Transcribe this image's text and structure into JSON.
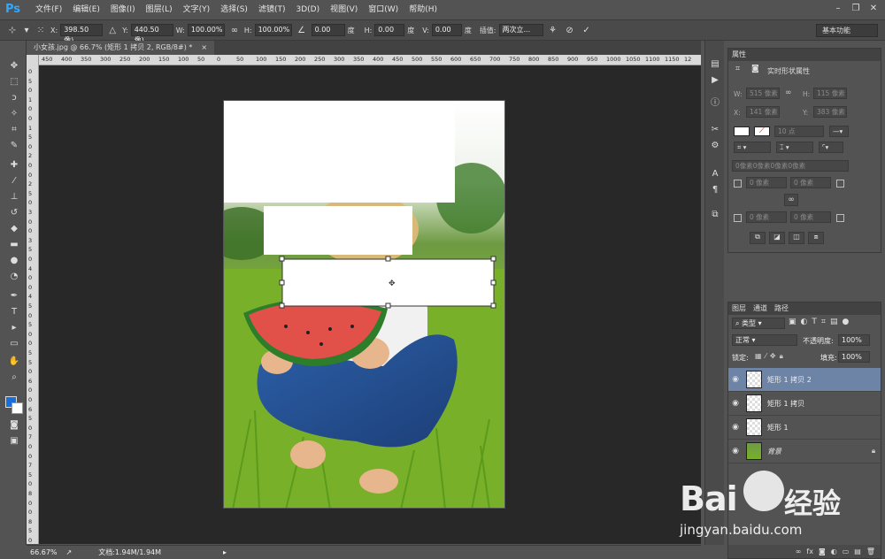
{
  "app": {
    "logo": "Ps"
  },
  "menu": [
    "文件(F)",
    "编辑(E)",
    "图像(I)",
    "图层(L)",
    "文字(Y)",
    "选择(S)",
    "滤镜(T)",
    "3D(D)",
    "视图(V)",
    "窗口(W)",
    "帮助(H)"
  ],
  "options": {
    "x_label": "X:",
    "x_value": "398.50 像)",
    "y_label": "Y:",
    "y_value": "440.50 像)",
    "w_label": "W:",
    "w_value": "100.00%",
    "h_label": "H:",
    "h_value": "100.00%",
    "angle_value": "0.00",
    "angle_unit": "度",
    "hskew_label": "H:",
    "hskew_value": "0.00",
    "hskew_unit": "度",
    "vskew_label": "V:",
    "vskew_value": "0.00",
    "vskew_unit": "度",
    "interp_label": "插值:",
    "interp_value": "两次立...",
    "workspace": "基本功能"
  },
  "document": {
    "tab_title": "小女孩.jpg @ 66.7% (矩形 1 拷贝 2, RGB/8#) *",
    "tab_close": "×",
    "zoom": "66.67%",
    "doc_info": "文档:1.94M/1.94M"
  },
  "ruler": {
    "h_ticks": [
      "450",
      "400",
      "350",
      "300",
      "250",
      "200",
      "150",
      "100",
      "50",
      "0",
      "50",
      "100",
      "150",
      "200",
      "250",
      "300",
      "350",
      "400",
      "450",
      "500",
      "550",
      "600",
      "650",
      "700",
      "750",
      "800",
      "850",
      "900",
      "950",
      "1000",
      "1050",
      "1100",
      "1150",
      "12"
    ],
    "v_ticks": [
      "0",
      "5",
      "0",
      "1",
      "0",
      "0",
      "1",
      "5",
      "0",
      "2",
      "0",
      "0",
      "2",
      "5",
      "0",
      "3",
      "0",
      "0",
      "3",
      "5",
      "0",
      "4",
      "0",
      "0",
      "4",
      "5",
      "0",
      "5",
      "0",
      "0",
      "5",
      "5",
      "0",
      "6",
      "0",
      "0",
      "6",
      "5",
      "0",
      "7",
      "0",
      "0",
      "7",
      "5",
      "0",
      "8",
      "0",
      "0",
      "8",
      "5",
      "0"
    ]
  },
  "properties": {
    "tab_label": "属性",
    "title": "实时形状属性",
    "w_label": "W:",
    "w_value": "515 像素",
    "h_label": "H:",
    "h_value": "115 像素",
    "x_label": "X:",
    "x_value": "141 像素",
    "y_label": "Y:",
    "y_value": "383 像素",
    "stroke_width": "10 点",
    "corner_all": "0像素0像素0像素0像素",
    "corner_tl": "0 像素",
    "corner_tr": "0 像素",
    "corner_bl": "0 像素",
    "corner_br": "0 像素"
  },
  "layers": {
    "tabs": [
      "图层",
      "通道",
      "路径"
    ],
    "filter_kind": "类型",
    "blend_mode": "正常",
    "opacity_label": "不透明度:",
    "opacity_value": "100%",
    "lock_label": "锁定:",
    "fill_label": "填充:",
    "fill_value": "100%",
    "items": [
      {
        "name": "矩形 1 拷贝 2",
        "selected": true
      },
      {
        "name": "矩形 1 拷贝",
        "selected": false
      },
      {
        "name": "矩形 1",
        "selected": false
      },
      {
        "name": "背景",
        "selected": false
      }
    ]
  },
  "watermark": {
    "brand_left": "Bai",
    "brand_right": "经验",
    "url": "jingyan.baidu.com"
  },
  "colors": {
    "selection": "#6d84a6",
    "foreground": "#1a6fd6",
    "background": "#ffffff"
  }
}
